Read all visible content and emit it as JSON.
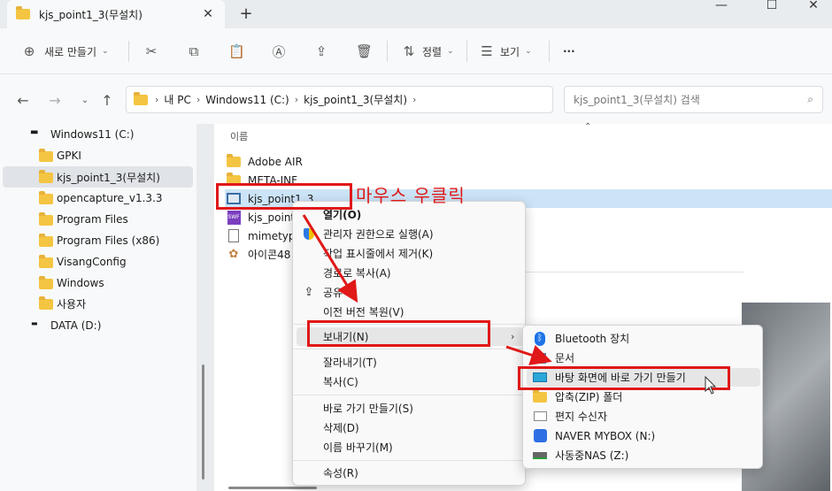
{
  "window": {
    "tab_title": "kjs_point1_3(무설치)",
    "tab_close": "✕",
    "new_tab": "+",
    "minimize": "—",
    "maximize": "☐",
    "close": "✕"
  },
  "toolbar": {
    "new_label": "새로 만들기",
    "sort_label": "정렬",
    "view_label": "보기",
    "more": "···"
  },
  "address": {
    "crumbs": [
      "내 PC",
      "Windows11 (C:)",
      "kjs_point1_3(무설치)"
    ],
    "search_placeholder": "kjs_point1_3(무설치) 검색"
  },
  "nav": {
    "items": [
      {
        "label": "Windows11 (C:)",
        "type": "drive"
      },
      {
        "label": "GPKI",
        "type": "folder"
      },
      {
        "label": "kjs_point1_3(무설치)",
        "type": "folder",
        "selected": true
      },
      {
        "label": "opencapture_v1.3.3",
        "type": "folder"
      },
      {
        "label": "Program Files",
        "type": "folder"
      },
      {
        "label": "Program Files (x86)",
        "type": "folder"
      },
      {
        "label": "VisangConfig",
        "type": "folder"
      },
      {
        "label": "Windows",
        "type": "folder"
      },
      {
        "label": "사용자",
        "type": "folder"
      },
      {
        "label": "DATA (D:)",
        "type": "drive"
      }
    ]
  },
  "content": {
    "column_name": "이름",
    "files": [
      {
        "label": "Adobe AIR",
        "type": "folder"
      },
      {
        "label": "META-INF",
        "type": "folder"
      },
      {
        "label": "kjs_point1_3",
        "type": "app",
        "selected": true
      },
      {
        "label": "kjs_point",
        "type": "swf"
      },
      {
        "label": "mimetyp",
        "type": "file"
      },
      {
        "label": "아이콘48",
        "type": "image"
      }
    ]
  },
  "context_menu": {
    "items": [
      {
        "label": "열기(O)",
        "bold": true
      },
      {
        "label": "관리자 권한으로 실행(A)",
        "icon": "shield"
      },
      {
        "label": "작업 표시줄에서 제거(K)"
      },
      {
        "label": "경로로 복사(A)"
      },
      {
        "label": "공유",
        "icon": "share"
      },
      {
        "label": "이전 버전 복원(V)"
      },
      {
        "label": "보내기(N)",
        "submenu": true
      },
      {
        "label": "잘라내기(T)"
      },
      {
        "label": "복사(C)"
      },
      {
        "label": "바로 가기 만들기(S)"
      },
      {
        "label": "삭제(D)"
      },
      {
        "label": "이름 바꾸기(M)"
      },
      {
        "label": "속성(R)"
      }
    ]
  },
  "submenu": {
    "items": [
      {
        "label": "Bluetooth 장치",
        "icon": "bluetooth"
      },
      {
        "label": "문서",
        "icon": "documents"
      },
      {
        "label": "바탕 화면에 바로 가기 만들기",
        "icon": "desktop"
      },
      {
        "label": "압축(ZIP) 폴더",
        "icon": "zip"
      },
      {
        "label": "편지 수신자",
        "icon": "mail"
      },
      {
        "label": "NAVER MYBOX (N:)",
        "icon": "naver-mybox"
      },
      {
        "label": "사동중NAS (Z:)",
        "icon": "network-drive"
      }
    ]
  },
  "annotation": {
    "text": "마우스 우클릭",
    "color": "#e01818"
  }
}
